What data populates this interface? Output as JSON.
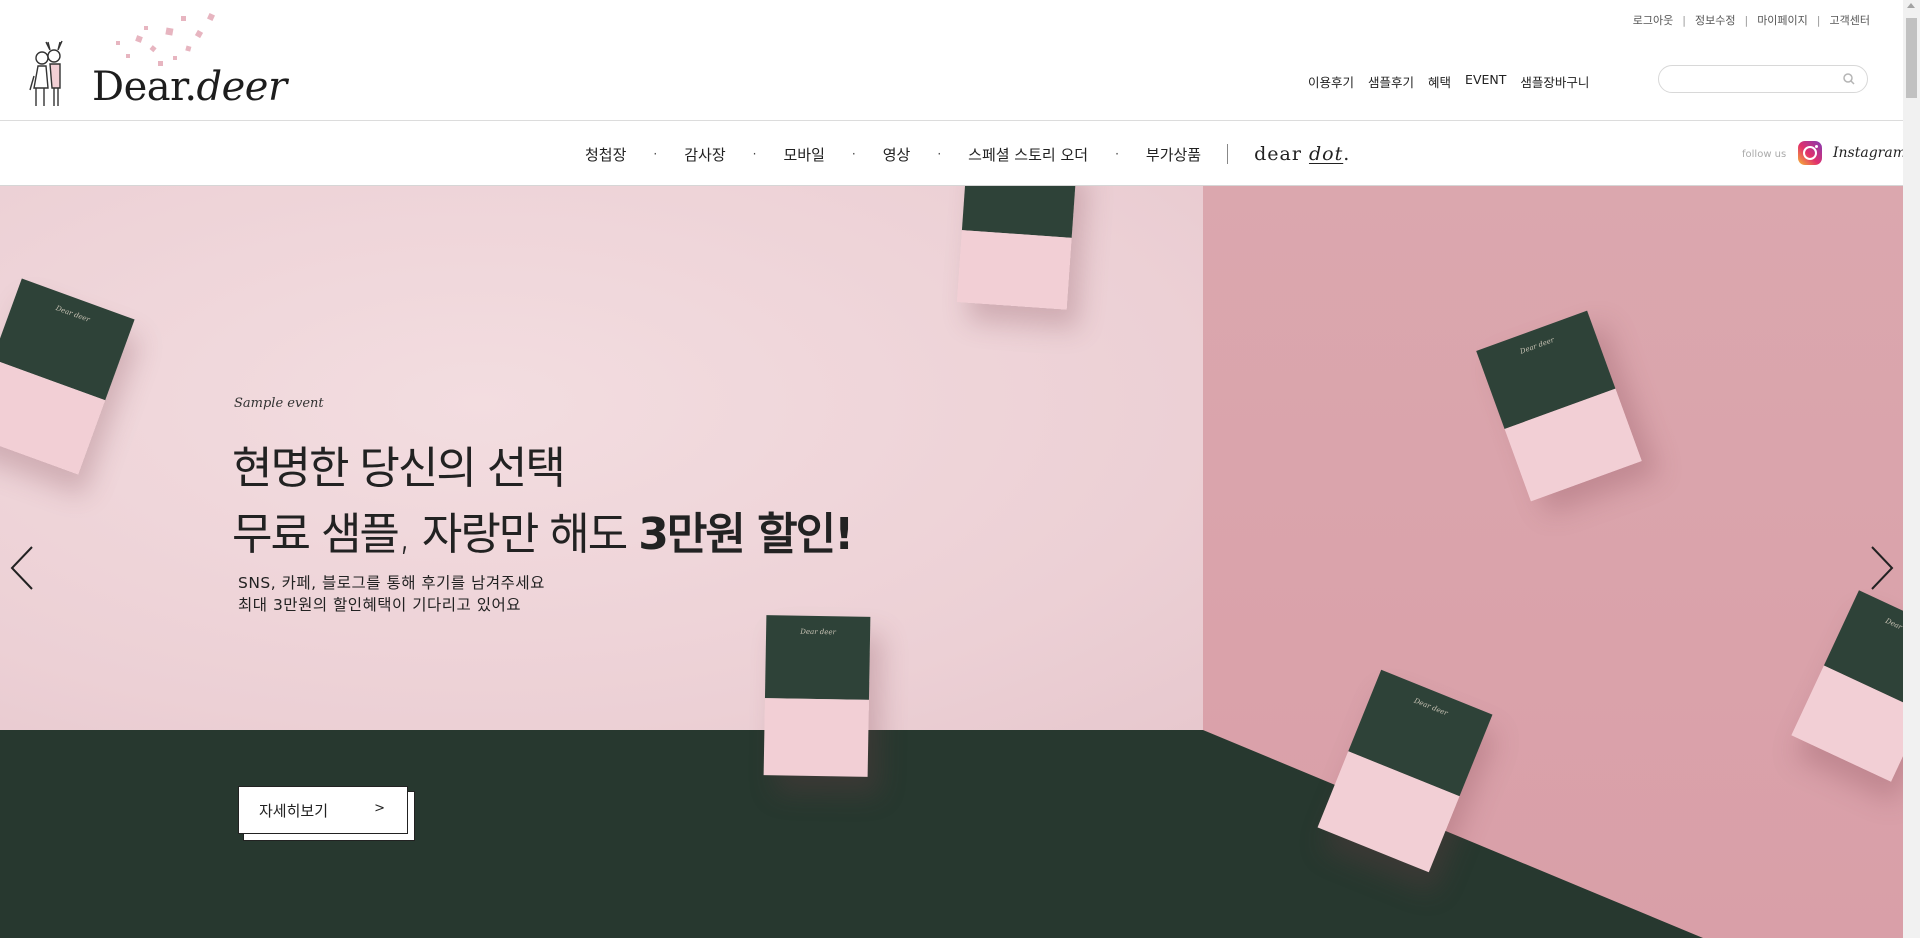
{
  "util_links": [
    "로그아웃",
    "정보수정",
    "마이페이지",
    "고객센터"
  ],
  "logo": {
    "part1": "Dear.",
    "part2": "deer"
  },
  "gnb": [
    "이용후기",
    "샘플후기",
    "혜택",
    "EVENT",
    "샘플장바구니"
  ],
  "search": {
    "placeholder": "",
    "value": ""
  },
  "categories": [
    "청첩장",
    "감사장",
    "모바일",
    "영상",
    "스페셜 스토리 오더",
    "부가상품"
  ],
  "deardot": {
    "part1": "dear ",
    "part2": "dot",
    "part3": "."
  },
  "follow": {
    "label": "follow us",
    "instagram": "Instagram"
  },
  "hero": {
    "sample": "Sample event",
    "line1": "현명한 당신의 선택",
    "line2_light": "무료 샘플, 자랑만 해도 ",
    "line2_bold": "3만원 할인!",
    "desc1": "SNS, 카페, 블로그를 통해 후기를 남겨주세요",
    "desc2": "최대 3만원의 할인혜택이 기다리고 있어요",
    "button": "자세히보기",
    "button_arrow": ">",
    "box_label": "Dear deer"
  },
  "colors": {
    "box_lid": "#2e4238",
    "box_body": "#f2cfd5",
    "floor": "#27382f",
    "wall_right": "#d99fa8"
  }
}
